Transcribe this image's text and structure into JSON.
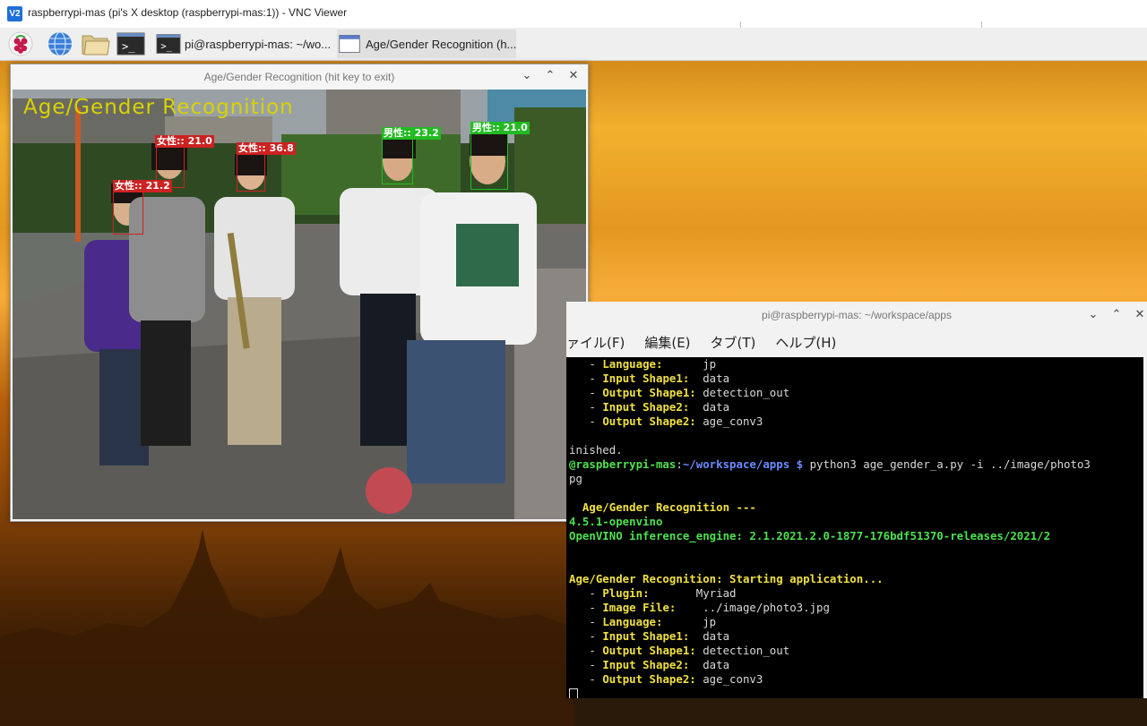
{
  "vnc": {
    "title": "raspberrypi-mas (pi's X desktop (raspberrypi-mas:1)) - VNC Viewer",
    "logo": "V2"
  },
  "taskbar": {
    "launchers": [
      "raspberry-menu-icon",
      "web-browser-icon",
      "file-manager-icon",
      "terminal-icon"
    ],
    "items": [
      {
        "label": "pi@raspberrypi-mas: ~/wo...",
        "icon": "terminal-icon",
        "active": false
      },
      {
        "label": "Age/Gender Recognition (h...",
        "icon": "window-icon",
        "active": true
      }
    ]
  },
  "recognition_window": {
    "title": "Age/Gender Recognition (hit key to exit)",
    "overlay_title": "Age/Gender Recognition",
    "faces": [
      {
        "gender": "女性:",
        "age": ": 21.0",
        "color": "#cc2222"
      },
      {
        "gender": "女性:",
        "age": ": 36.8",
        "color": "#cc2222"
      },
      {
        "gender": "女性:",
        "age": ": 21.2",
        "color": "#cc2222"
      },
      {
        "gender": "男性:",
        "age": ": 23.2",
        "color": "#22bb22"
      },
      {
        "gender": "男性:",
        "age": ": 21.0",
        "color": "#22bb22"
      }
    ],
    "buttons": {
      "minimize": "⌄",
      "maximize": "⌃",
      "close": "✕"
    }
  },
  "terminal": {
    "title": "pi@raspberrypi-mas: ~/workspace/apps",
    "menu": [
      "ァイル(F)",
      "編集(E)",
      "タブ(T)",
      "ヘルプ(H)"
    ],
    "lines": [
      [
        {
          "t": "   - ",
          "c": "w"
        },
        {
          "t": "Language:",
          "c": "y"
        },
        {
          "t": "      jp",
          "c": "w"
        }
      ],
      [
        {
          "t": "   - ",
          "c": "w"
        },
        {
          "t": "Input Shape1:",
          "c": "y"
        },
        {
          "t": "  data",
          "c": "w"
        }
      ],
      [
        {
          "t": "   - ",
          "c": "w"
        },
        {
          "t": "Output Shape1:",
          "c": "y"
        },
        {
          "t": " detection_out",
          "c": "w"
        }
      ],
      [
        {
          "t": "   - ",
          "c": "w"
        },
        {
          "t": "Input Shape2:",
          "c": "y"
        },
        {
          "t": "  data",
          "c": "w"
        }
      ],
      [
        {
          "t": "   - ",
          "c": "w"
        },
        {
          "t": "Output Shape2:",
          "c": "y"
        },
        {
          "t": " age_conv3",
          "c": "w"
        }
      ],
      [
        {
          "t": "",
          "c": "w"
        }
      ],
      [
        {
          "t": "inished.",
          "c": "w"
        }
      ],
      [
        {
          "t": "@raspberrypi-mas",
          "c": "g"
        },
        {
          "t": ":",
          "c": "w"
        },
        {
          "t": "~/workspace/apps $",
          "c": "b"
        },
        {
          "t": " python3 age_gender_a.py -i ../image/photo3",
          "c": "w"
        }
      ],
      [
        {
          "t": "pg",
          "c": "w"
        }
      ],
      [
        {
          "t": "",
          "c": "w"
        }
      ],
      [
        {
          "t": "  Age/Gender Recognition ---",
          "c": "y"
        }
      ],
      [
        {
          "t": "4.5.1-openvino",
          "c": "g"
        }
      ],
      [
        {
          "t": "OpenVINO inference_engine: 2.1.2021.2.0-1877-176bdf51370-releases/2021/2",
          "c": "g"
        }
      ],
      [
        {
          "t": "",
          "c": "w"
        }
      ],
      [
        {
          "t": "",
          "c": "w"
        }
      ],
      [
        {
          "t": "Age/Gender Recognition: Starting application...",
          "c": "y"
        }
      ],
      [
        {
          "t": "   - ",
          "c": "w"
        },
        {
          "t": "Plugin:",
          "c": "y"
        },
        {
          "t": "       Myriad",
          "c": "w"
        }
      ],
      [
        {
          "t": "   - ",
          "c": "w"
        },
        {
          "t": "Image File:",
          "c": "y"
        },
        {
          "t": "    ../image/photo3.jpg",
          "c": "w"
        }
      ],
      [
        {
          "t": "   - ",
          "c": "w"
        },
        {
          "t": "Language:",
          "c": "y"
        },
        {
          "t": "      jp",
          "c": "w"
        }
      ],
      [
        {
          "t": "   - ",
          "c": "w"
        },
        {
          "t": "Input Shape1:",
          "c": "y"
        },
        {
          "t": "  data",
          "c": "w"
        }
      ],
      [
        {
          "t": "   - ",
          "c": "w"
        },
        {
          "t": "Output Shape1:",
          "c": "y"
        },
        {
          "t": " detection_out",
          "c": "w"
        }
      ],
      [
        {
          "t": "   - ",
          "c": "w"
        },
        {
          "t": "Input Shape2:",
          "c": "y"
        },
        {
          "t": "  data",
          "c": "w"
        }
      ],
      [
        {
          "t": "   - ",
          "c": "w"
        },
        {
          "t": "Output Shape2:",
          "c": "y"
        },
        {
          "t": " age_conv3",
          "c": "w"
        }
      ]
    ],
    "buttons": {
      "minimize": "⌄",
      "maximize": "⌃",
      "close": "✕"
    }
  }
}
